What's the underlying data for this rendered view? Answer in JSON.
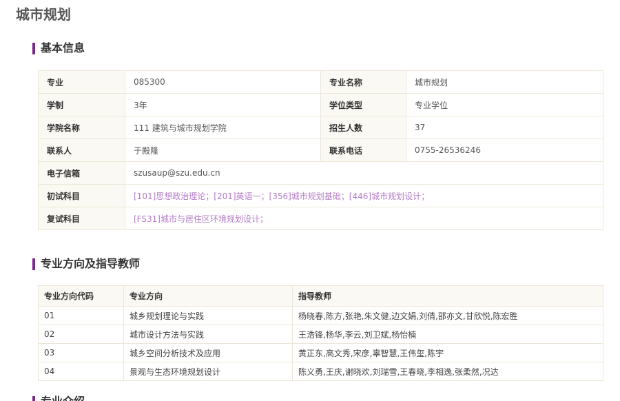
{
  "page_title": "城市规划",
  "basic_info": {
    "heading": "基本信息",
    "rows": [
      {
        "l1": "专业",
        "v1": "085300",
        "l2": "专业名称",
        "v2": "城市规划"
      },
      {
        "l1": "学制",
        "v1": "3年",
        "l2": "学位类型",
        "v2": "专业学位"
      },
      {
        "l1": "学院名称",
        "v1": "111 建筑与城市规划学院",
        "l2": "招生人数",
        "v2": "37"
      },
      {
        "l1": "联系人",
        "v1": "于殿隆",
        "l2": "联系电话",
        "v2": "0755-26536246"
      }
    ],
    "email_label": "电子信箱",
    "email": "szusaup@szu.edu.cn",
    "exam_label": "初试科目",
    "exam_subjects": "[101]思想政治理论；[201]英语一；[356]城市规划基础；[446]城市规划设计；",
    "retest_label": "复试科目",
    "retest_subjects": "[FS31]城市与居住区环境规划设计；",
    "link_color": "#b57cc8"
  },
  "directions": {
    "heading": "专业方向及指导教师",
    "columns": [
      "专业方向代码",
      "专业方向",
      "指导教师"
    ],
    "rows": [
      {
        "code": "01",
        "name": "城乡规划理论与实践",
        "teachers": "杨晓春,陈方,张艳,朱文健,边文娟,刘倩,邵亦文,甘欣悦,陈宏胜"
      },
      {
        "code": "02",
        "name": "城市设计方法与实践",
        "teachers": "王浩锋,杨华,李云,刘卫斌,杨怡楠"
      },
      {
        "code": "03",
        "name": "城乡空间分析技术及应用",
        "teachers": "黄正东,高文秀,宋彦,辜智慧,王伟玺,陈宇"
      },
      {
        "code": "04",
        "name": "景观与生态环境规划设计",
        "teachers": "陈义勇,王庆,谢晓欢,刘瑞雪,王春晓,李相逸,张柔然,况达"
      }
    ]
  },
  "next_section_heading": "专业介绍",
  "accent_color": "#7a2a8c"
}
